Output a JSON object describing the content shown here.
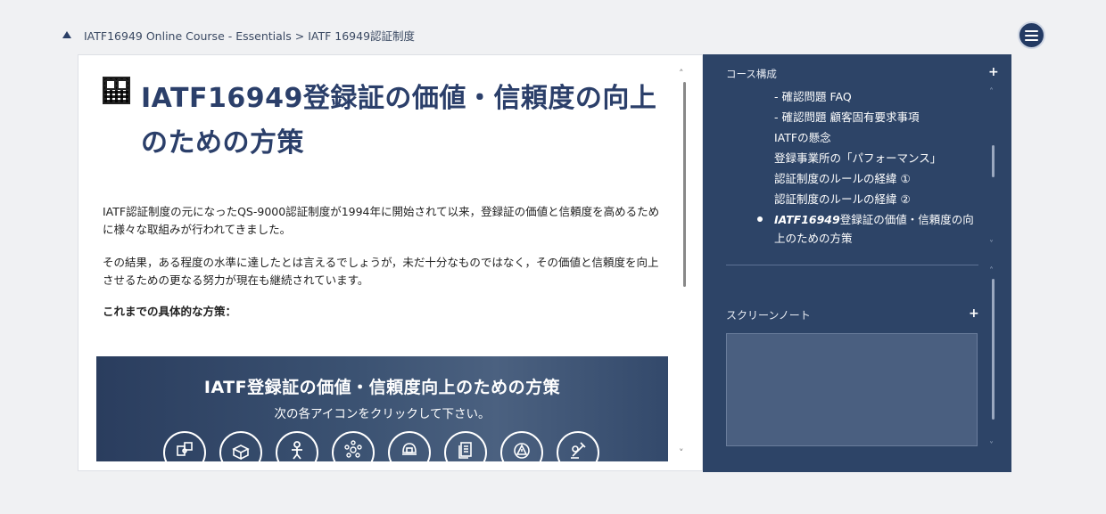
{
  "breadcrumb": "IATF16949 Online Course - Essentials > IATF 16949認証制度",
  "content": {
    "title_bold": "IATF16949",
    "title_rest": "登録証の価値・信頼度の向上のための方策",
    "paragraph1": "IATF認証制度の元になったQS-9000認証制度が1994年に開始されて以来，登録証の価値と信頼度を高めるために様々な取組みが行われてきました。",
    "paragraph2": "その結果，ある程度の水準に達したとは言えるでしょうが，未だ十分なものではなく，その価値と信頼度を向上させるための更なる努力が現在も継続されています。",
    "paragraph3": "これまでの具体的な方策：",
    "banner": {
      "title": "IATF登録証の価値・信頼度向上のための方策",
      "subtitle": "次の各アイコンをクリックして下さい。",
      "icons": [
        "puzzle-icon",
        "boxes-icon",
        "person-icon",
        "network-icon",
        "helmet-icon",
        "documents-icon",
        "warning-gear-icon",
        "auditor-icon"
      ]
    },
    "scroll_up": "˄",
    "scroll_down": "˅"
  },
  "sidebar": {
    "header": "コース構成",
    "plus": "+",
    "toc": [
      {
        "label": "- 確認問題 FAQ"
      },
      {
        "label": "- 確認問題 顧客固有要求事項"
      },
      {
        "label": "IATFの懸念"
      },
      {
        "label": "登録事業所の「パフォーマンス」"
      },
      {
        "label": "認証制度のルールの経緯 ①"
      },
      {
        "label": "認証制度のルールの経緯 ②"
      }
    ],
    "active_bold": "IATF16949",
    "active_rest": "登録証の価値・信頼度の向上のための方策",
    "notes_label": "スクリーンノート",
    "notes_plus": "+"
  }
}
